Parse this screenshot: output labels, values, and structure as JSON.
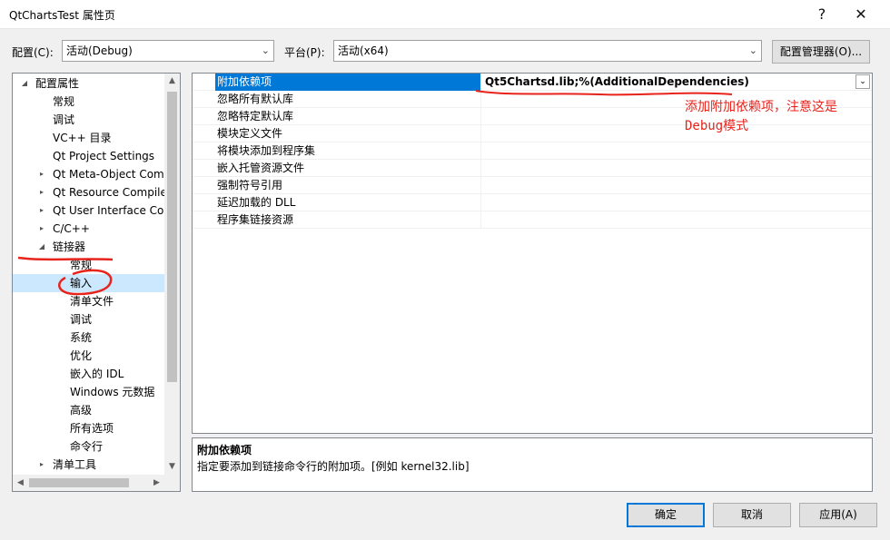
{
  "window": {
    "title": "QtChartsTest 属性页",
    "help_label": "?",
    "close_label": "✕"
  },
  "config": {
    "config_label": "配置(C):",
    "config_value": "活动(Debug)",
    "platform_label": "平台(P):",
    "platform_value": "活动(x64)",
    "manager_label": "配置管理器(O)..."
  },
  "tree": {
    "root": "配置属性",
    "items": [
      {
        "label": "常规"
      },
      {
        "label": "调试"
      },
      {
        "label": "VC++ 目录"
      },
      {
        "label": "Qt Project Settings"
      },
      {
        "label": "Qt Meta-Object Compiler"
      },
      {
        "label": "Qt Resource Compiler"
      },
      {
        "label": "Qt User Interface Compiler"
      },
      {
        "label": "C/C++"
      },
      {
        "label": "链接器"
      },
      {
        "label": "常规"
      },
      {
        "label": "输入"
      },
      {
        "label": "清单文件"
      },
      {
        "label": "调试"
      },
      {
        "label": "系统"
      },
      {
        "label": "优化"
      },
      {
        "label": "嵌入的 IDL"
      },
      {
        "label": "Windows 元数据"
      },
      {
        "label": "高级"
      },
      {
        "label": "所有选项"
      },
      {
        "label": "命令行"
      },
      {
        "label": "清单工具"
      }
    ]
  },
  "properties": [
    {
      "name": "附加依赖项",
      "value": "Qt5Chartsd.lib;%(AdditionalDependencies)"
    },
    {
      "name": "忽略所有默认库",
      "value": ""
    },
    {
      "name": "忽略特定默认库",
      "value": ""
    },
    {
      "name": "模块定义文件",
      "value": ""
    },
    {
      "name": "将模块添加到程序集",
      "value": ""
    },
    {
      "name": "嵌入托管资源文件",
      "value": ""
    },
    {
      "name": "强制符号引用",
      "value": ""
    },
    {
      "name": "延迟加载的 DLL",
      "value": ""
    },
    {
      "name": "程序集链接资源",
      "value": ""
    }
  ],
  "description": {
    "title": "附加依赖项",
    "text": "指定要添加到链接命令行的附加项。[例如 kernel32.lib]"
  },
  "annotation": {
    "line1": "添加附加依赖项，注意这是",
    "line2": "Debug模式",
    "color": "#e8231c"
  },
  "buttons": {
    "ok": "确定",
    "cancel": "取消",
    "apply": "应用(A)"
  }
}
